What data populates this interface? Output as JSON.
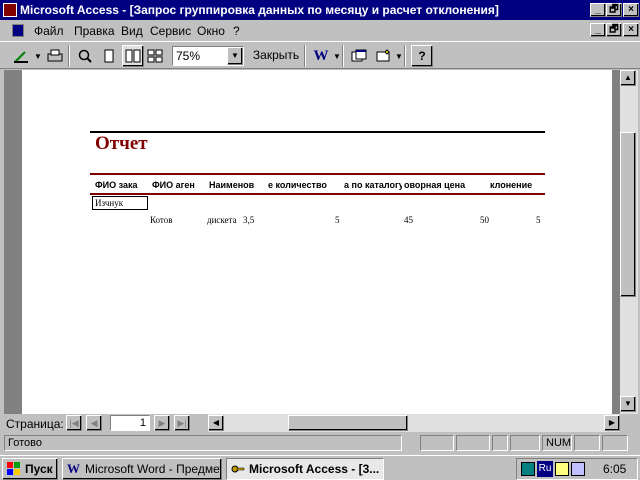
{
  "window": {
    "title": "Microsoft Access - [Запрос группировка данных по месяцу и расчет отклонения]",
    "caption_buttons": {
      "minimize": "_",
      "restore": "🗗",
      "close": "×"
    },
    "doc_buttons": {
      "minimize": "_",
      "restore": "🗗",
      "close": "×"
    }
  },
  "menu": [
    "Файл",
    "Правка",
    "Вид",
    "Сервис",
    "Окно",
    "?"
  ],
  "toolbar": {
    "zoom_value": "75%",
    "close_label": "Закрыть"
  },
  "report": {
    "title": "Отчет",
    "columns": [
      "ФИО зака",
      "ФИО аген",
      "Наименов",
      "е количество",
      "а по каталогу",
      "оворная цена",
      "клонение"
    ],
    "group_label": "Изчнук",
    "row": {
      "agent": "Котов",
      "item": "дискета",
      "size": "3,5",
      "quantity": "5",
      "catalog_price": "45",
      "contract_price": "50",
      "deviation": "5"
    },
    "accent_color": "#800000"
  },
  "nav": {
    "label": "Страница:",
    "page": "1"
  },
  "status": {
    "text": "Готово",
    "num": "NUM"
  },
  "taskbar": {
    "start": "Пуск",
    "tasks": [
      "Microsoft Word - Предмет...",
      "Microsoft Access - [3..."
    ],
    "lang": "Ru",
    "clock": "6:05"
  }
}
